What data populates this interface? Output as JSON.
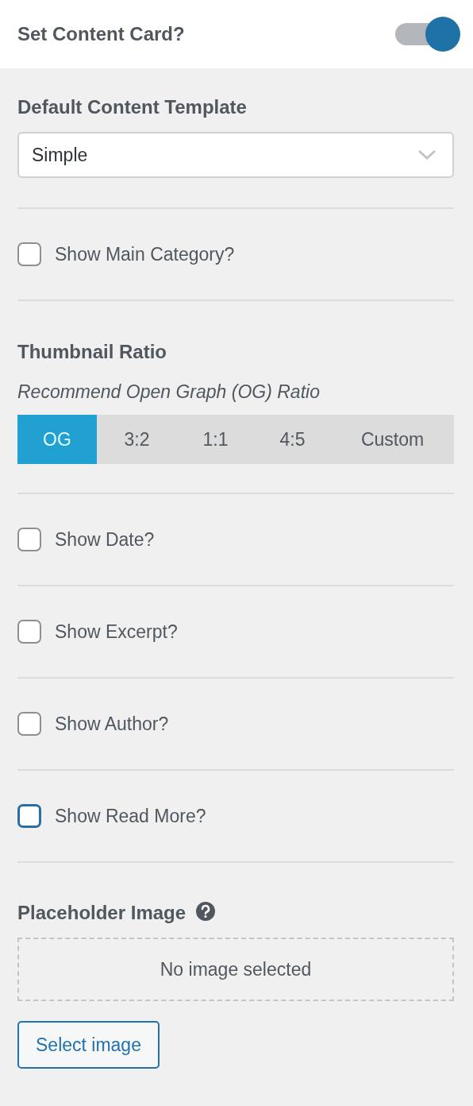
{
  "header": {
    "title": "Set Content Card?",
    "on": true
  },
  "sections": [
    {
      "kind": "select",
      "label": "Default Content Template",
      "value": "Simple"
    },
    {
      "kind": "checkbox",
      "label": "Show Main Category?",
      "checked": false,
      "focused": false
    },
    {
      "kind": "ratio",
      "title": "Thumbnail Ratio",
      "hint": "Recommend Open Graph (OG) Ratio",
      "options": [
        {
          "label": "OG",
          "selected": true
        },
        {
          "label": "3:2",
          "selected": false
        },
        {
          "label": "1:1",
          "selected": false
        },
        {
          "label": "4:5",
          "selected": false
        },
        {
          "label": "Custom",
          "selected": false
        }
      ]
    },
    {
      "kind": "checkbox",
      "label": "Show Date?",
      "checked": false,
      "focused": false
    },
    {
      "kind": "checkbox",
      "label": "Show Excerpt?",
      "checked": false,
      "focused": false
    },
    {
      "kind": "checkbox",
      "label": "Show Author?",
      "checked": false,
      "focused": false
    },
    {
      "kind": "checkbox",
      "label": "Show Read More?",
      "checked": false,
      "focused": true
    },
    {
      "kind": "image",
      "title": "Placeholder Image",
      "status": "No image selected",
      "button": "Select image"
    }
  ]
}
